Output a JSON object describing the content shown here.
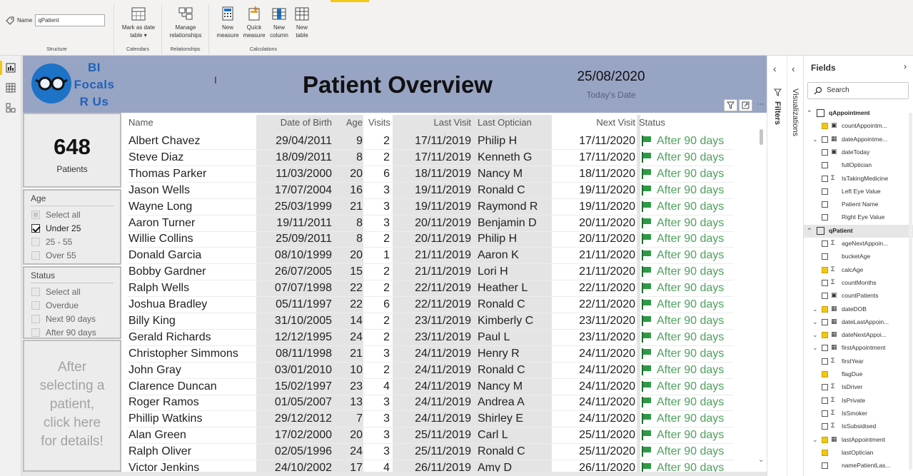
{
  "ribbon": {
    "name_label": "Name",
    "name_value": "qPatient",
    "groups": {
      "structure": "Structure",
      "calendars": "Calendars",
      "relationships": "Relationships",
      "calculations": "Calculations"
    },
    "buttons": {
      "mark_date_1": "Mark as date",
      "mark_date_2": "table ▾",
      "manage_rel_1": "Manage",
      "manage_rel_2": "relationships",
      "new_measure_1": "New",
      "new_measure_2": "measure",
      "quick_measure_1": "Quick",
      "quick_measure_2": "measure",
      "new_column_1": "New",
      "new_column_2": "column",
      "new_table_1": "New",
      "new_table_2": "table"
    }
  },
  "banner": {
    "logo_line1": "BI",
    "logo_line2": "Focals",
    "logo_line3": "R Us",
    "title": "Patient Overview",
    "date": "25/08/2020",
    "date_caption": "Today's Date"
  },
  "kpi": {
    "value": "648",
    "label": "Patients"
  },
  "age_slicer": {
    "title": "Age",
    "items": [
      {
        "label": "Select all",
        "state": "partial"
      },
      {
        "label": "Under 25",
        "state": "checked"
      },
      {
        "label": "25 - 55",
        "state": "unchecked"
      },
      {
        "label": "Over 55",
        "state": "unchecked"
      }
    ]
  },
  "status_slicer": {
    "title": "Status",
    "items": [
      {
        "label": "Select all",
        "state": "unchecked"
      },
      {
        "label": "Overdue",
        "state": "unchecked"
      },
      {
        "label": "Next 90 days",
        "state": "unchecked"
      },
      {
        "label": "After 90 days",
        "state": "unchecked"
      }
    ]
  },
  "detail_prompt": {
    "line1": "After",
    "line2": "selecting a",
    "line3": "patient,",
    "line4": "click here",
    "line5": "for details!"
  },
  "table": {
    "headers": {
      "name": "Name",
      "dob": "Date of Birth",
      "age": "Age",
      "visits": "Visits",
      "last_visit": "Last Visit",
      "last_optician": "Last Optician",
      "next_visit": "Next Visit",
      "status": "Status"
    },
    "status_color": "#4ea05d",
    "rows": [
      {
        "name": "Albert Chavez",
        "dob": "29/04/2011",
        "age": "9",
        "visits": "2",
        "last_visit": "17/11/2019",
        "optician": "Philip H",
        "next_visit": "17/11/2020",
        "status": "After 90 days"
      },
      {
        "name": "Steve Diaz",
        "dob": "18/09/2011",
        "age": "8",
        "visits": "2",
        "last_visit": "17/11/2019",
        "optician": "Kenneth G",
        "next_visit": "17/11/2020",
        "status": "After 90 days"
      },
      {
        "name": "Thomas Parker",
        "dob": "11/03/2000",
        "age": "20",
        "visits": "6",
        "last_visit": "18/11/2019",
        "optician": "Nancy M",
        "next_visit": "18/11/2020",
        "status": "After 90 days"
      },
      {
        "name": "Jason Wells",
        "dob": "17/07/2004",
        "age": "16",
        "visits": "3",
        "last_visit": "19/11/2019",
        "optician": "Ronald C",
        "next_visit": "19/11/2020",
        "status": "After 90 days"
      },
      {
        "name": "Wayne Long",
        "dob": "25/03/1999",
        "age": "21",
        "visits": "3",
        "last_visit": "19/11/2019",
        "optician": "Raymond R",
        "next_visit": "19/11/2020",
        "status": "After 90 days"
      },
      {
        "name": "Aaron Turner",
        "dob": "19/11/2011",
        "age": "8",
        "visits": "3",
        "last_visit": "20/11/2019",
        "optician": "Benjamin D",
        "next_visit": "20/11/2020",
        "status": "After 90 days"
      },
      {
        "name": "Willie Collins",
        "dob": "25/09/2011",
        "age": "8",
        "visits": "2",
        "last_visit": "20/11/2019",
        "optician": "Philip H",
        "next_visit": "20/11/2020",
        "status": "After 90 days"
      },
      {
        "name": "Donald Garcia",
        "dob": "08/10/1999",
        "age": "20",
        "visits": "1",
        "last_visit": "21/11/2019",
        "optician": "Aaron K",
        "next_visit": "21/11/2020",
        "status": "After 90 days"
      },
      {
        "name": "Bobby Gardner",
        "dob": "26/07/2005",
        "age": "15",
        "visits": "2",
        "last_visit": "21/11/2019",
        "optician": "Lori H",
        "next_visit": "21/11/2020",
        "status": "After 90 days"
      },
      {
        "name": "Ralph Wells",
        "dob": "07/07/1998",
        "age": "22",
        "visits": "2",
        "last_visit": "22/11/2019",
        "optician": "Heather L",
        "next_visit": "22/11/2020",
        "status": "After 90 days"
      },
      {
        "name": "Joshua Bradley",
        "dob": "05/11/1997",
        "age": "22",
        "visits": "6",
        "last_visit": "22/11/2019",
        "optician": "Ronald C",
        "next_visit": "22/11/2020",
        "status": "After 90 days"
      },
      {
        "name": "Billy King",
        "dob": "31/10/2005",
        "age": "14",
        "visits": "2",
        "last_visit": "23/11/2019",
        "optician": "Kimberly C",
        "next_visit": "23/11/2020",
        "status": "After 90 days"
      },
      {
        "name": "Gerald Richards",
        "dob": "12/12/1995",
        "age": "24",
        "visits": "2",
        "last_visit": "23/11/2019",
        "optician": "Paul L",
        "next_visit": "23/11/2020",
        "status": "After 90 days"
      },
      {
        "name": "Christopher Simmons",
        "dob": "08/11/1998",
        "age": "21",
        "visits": "3",
        "last_visit": "24/11/2019",
        "optician": "Henry R",
        "next_visit": "24/11/2020",
        "status": "After 90 days"
      },
      {
        "name": "John Gray",
        "dob": "03/01/2010",
        "age": "10",
        "visits": "2",
        "last_visit": "24/11/2019",
        "optician": "Ronald C",
        "next_visit": "24/11/2020",
        "status": "After 90 days"
      },
      {
        "name": "Clarence Duncan",
        "dob": "15/02/1997",
        "age": "23",
        "visits": "4",
        "last_visit": "24/11/2019",
        "optician": "Nancy M",
        "next_visit": "24/11/2020",
        "status": "After 90 days"
      },
      {
        "name": "Roger Ramos",
        "dob": "01/05/2007",
        "age": "13",
        "visits": "3",
        "last_visit": "24/11/2019",
        "optician": "Andrea A",
        "next_visit": "24/11/2020",
        "status": "After 90 days"
      },
      {
        "name": "Phillip Watkins",
        "dob": "29/12/2012",
        "age": "7",
        "visits": "3",
        "last_visit": "24/11/2019",
        "optician": "Shirley E",
        "next_visit": "24/11/2020",
        "status": "After 90 days"
      },
      {
        "name": "Alan Green",
        "dob": "17/02/2000",
        "age": "20",
        "visits": "3",
        "last_visit": "25/11/2019",
        "optician": "Carl L",
        "next_visit": "25/11/2020",
        "status": "After 90 days"
      },
      {
        "name": "Ralph Oliver",
        "dob": "02/05/1996",
        "age": "24",
        "visits": "3",
        "last_visit": "25/11/2019",
        "optician": "Ronald C",
        "next_visit": "25/11/2020",
        "status": "After 90 days"
      },
      {
        "name": "Victor Jenkins",
        "dob": "24/10/2002",
        "age": "17",
        "visits": "4",
        "last_visit": "26/11/2019",
        "optician": "Amy D",
        "next_visit": "26/11/2020",
        "status": "After 90 days"
      }
    ]
  },
  "panes": {
    "filters": "Filters",
    "visualizations": "Visualizations",
    "fields_title": "Fields",
    "search_placeholder": "Search"
  },
  "fields": [
    {
      "kind": "table",
      "label": "qAppointment",
      "caret": "^"
    },
    {
      "kind": "field",
      "label": "countAppointm...",
      "check": "yellow",
      "sym": "calc",
      "caret": ""
    },
    {
      "kind": "field",
      "label": "dateAppointme...",
      "check": "box",
      "sym": "date",
      "caret": "v"
    },
    {
      "kind": "field",
      "label": "dateToday",
      "check": "box",
      "sym": "calc",
      "caret": ""
    },
    {
      "kind": "field",
      "label": "fullOptician",
      "check": "box",
      "sym": "",
      "caret": ""
    },
    {
      "kind": "field",
      "label": "IsTakingMedicine",
      "check": "box",
      "sym": "sigma",
      "caret": ""
    },
    {
      "kind": "field",
      "label": "Left Eye Value",
      "check": "box",
      "sym": "",
      "caret": ""
    },
    {
      "kind": "field",
      "label": "Patient Name",
      "check": "box",
      "sym": "",
      "caret": ""
    },
    {
      "kind": "field",
      "label": "Right Eye Value",
      "check": "box",
      "sym": "",
      "caret": ""
    },
    {
      "kind": "table",
      "label": "qPatient",
      "caret": "^"
    },
    {
      "kind": "field",
      "label": "ageNextAppoin...",
      "check": "box",
      "sym": "sigma",
      "caret": ""
    },
    {
      "kind": "field",
      "label": "bucketAge",
      "check": "box",
      "sym": "",
      "caret": ""
    },
    {
      "kind": "field",
      "label": "calcAge",
      "check": "yellow",
      "sym": "sigma",
      "caret": ""
    },
    {
      "kind": "field",
      "label": "countMonths",
      "check": "box",
      "sym": "sigma",
      "caret": ""
    },
    {
      "kind": "field",
      "label": "countPatients",
      "check": "box",
      "sym": "calc",
      "caret": ""
    },
    {
      "kind": "field",
      "label": "dateDOB",
      "check": "yellow",
      "sym": "date",
      "caret": "v"
    },
    {
      "kind": "field",
      "label": "dateLastAppoin...",
      "check": "box",
      "sym": "date",
      "caret": "v"
    },
    {
      "kind": "field",
      "label": "dateNextAppoi...",
      "check": "yellow",
      "sym": "date",
      "caret": "v"
    },
    {
      "kind": "field",
      "label": "firstAppointment",
      "check": "box",
      "sym": "date",
      "caret": "v"
    },
    {
      "kind": "field",
      "label": "firstYear",
      "check": "box",
      "sym": "sigma",
      "caret": ""
    },
    {
      "kind": "field",
      "label": "flagDue",
      "check": "yellow",
      "sym": "",
      "caret": ""
    },
    {
      "kind": "field",
      "label": "IsDriver",
      "check": "box",
      "sym": "sigma",
      "caret": ""
    },
    {
      "kind": "field",
      "label": "IsPrivate",
      "check": "box",
      "sym": "sigma",
      "caret": ""
    },
    {
      "kind": "field",
      "label": "IsSmoker",
      "check": "box",
      "sym": "sigma",
      "caret": ""
    },
    {
      "kind": "field",
      "label": "IsSubsidised",
      "check": "box",
      "sym": "sigma",
      "caret": ""
    },
    {
      "kind": "field",
      "label": "lastAppointment",
      "check": "yellow",
      "sym": "date",
      "caret": "v"
    },
    {
      "kind": "field",
      "label": "lastOptician",
      "check": "yellow",
      "sym": "",
      "caret": ""
    },
    {
      "kind": "field",
      "label": "namePatientLas...",
      "check": "box",
      "sym": "",
      "caret": ""
    }
  ]
}
